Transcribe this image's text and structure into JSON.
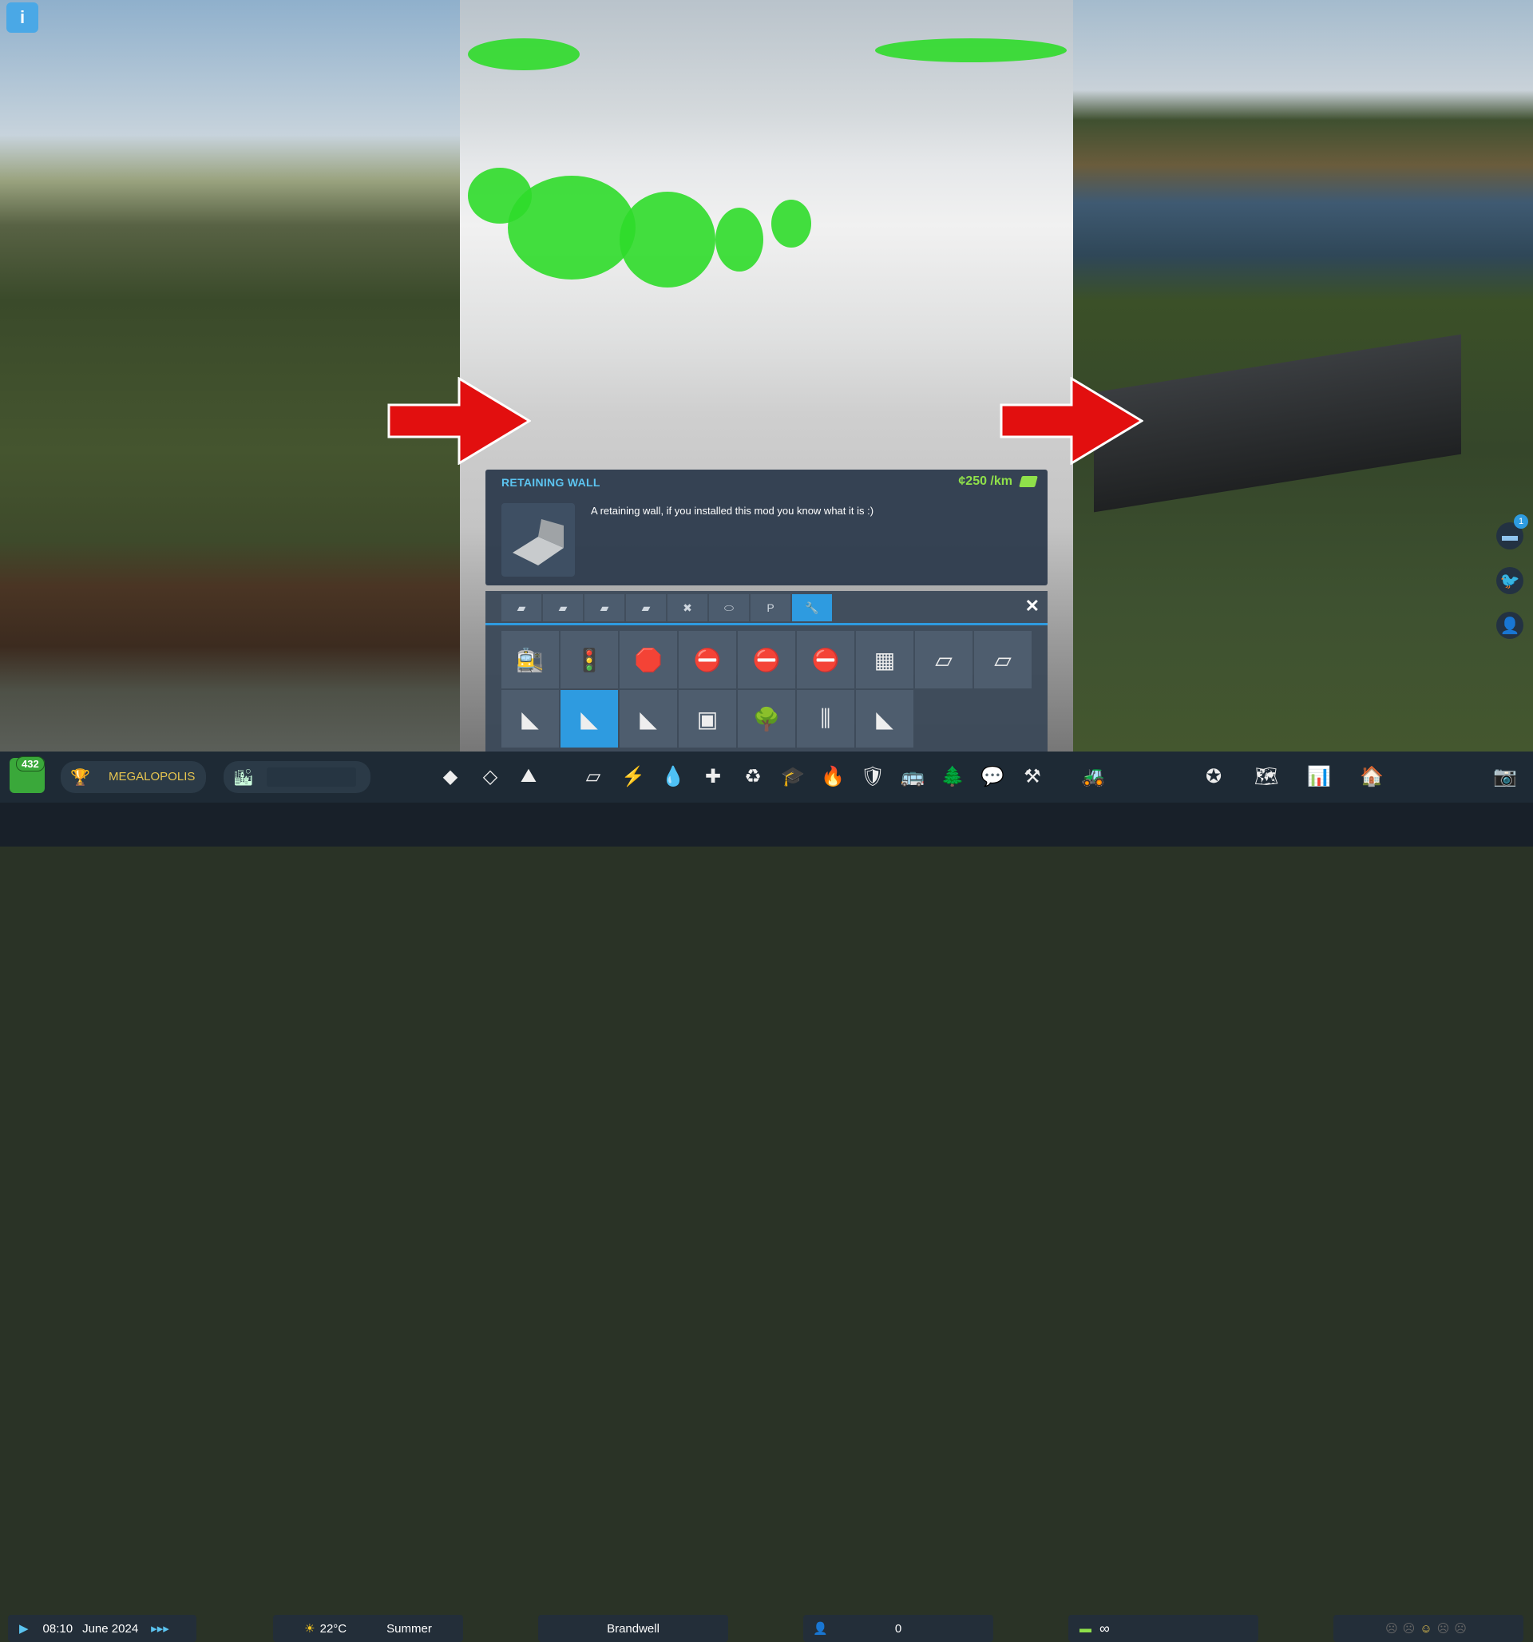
{
  "info": {
    "title": "RETAINING WALL",
    "price": "¢250 /km",
    "description": "A retaining wall, if you installed this mod you know what it is :)"
  },
  "tabs": [
    "road-straight",
    "road-two-lane",
    "road-highway",
    "road-park",
    "intersection",
    "roundabout",
    "parking",
    "tools"
  ],
  "grid": [
    {
      "name": "train-station",
      "glyph": "🚉"
    },
    {
      "name": "traffic-light",
      "glyph": "🚦"
    },
    {
      "name": "stop-sign",
      "glyph": "🛑"
    },
    {
      "name": "no-left-turn-sign",
      "glyph": "⛔"
    },
    {
      "name": "no-u-turn-sign",
      "glyph": "⛔"
    },
    {
      "name": "no-right-turn-sign",
      "glyph": "⛔"
    },
    {
      "name": "crosswalk",
      "glyph": "▦"
    },
    {
      "name": "road-piece",
      "glyph": "▱"
    },
    {
      "name": "green-road",
      "glyph": "▱"
    },
    {
      "name": "quay-wall",
      "glyph": "◣"
    },
    {
      "name": "retaining-wall",
      "glyph": "◣"
    },
    {
      "name": "tunnel-wall",
      "glyph": "◣"
    },
    {
      "name": "box-wall",
      "glyph": "▣"
    },
    {
      "name": "tree-lane",
      "glyph": "🌳"
    },
    {
      "name": "bridge-piece",
      "glyph": "⫼"
    },
    {
      "name": "embankment",
      "glyph": "◣"
    }
  ],
  "badge": {
    "count": "432",
    "milestone": "MEGALOPOLIS"
  },
  "time": "08:10",
  "date": "June 2024",
  "weather": {
    "temp": "22°C",
    "season": "Summer"
  },
  "city": "Brandwell",
  "population": "0",
  "money": "∞",
  "notification_count": "1",
  "toolbar_icons": [
    "zoning",
    "area",
    "landscape",
    "roads",
    "electricity",
    "water",
    "healthcare",
    "garbage",
    "education",
    "fire",
    "police",
    "transport",
    "parks",
    "communications",
    "shovel",
    "bulldozer",
    "achievements",
    "map",
    "statistics",
    "city-services",
    "camera"
  ],
  "colors": {
    "accent": "#2e9be0",
    "title": "#5cc4f0",
    "price": "#8fe04a",
    "arrow": "#e20f0f"
  }
}
